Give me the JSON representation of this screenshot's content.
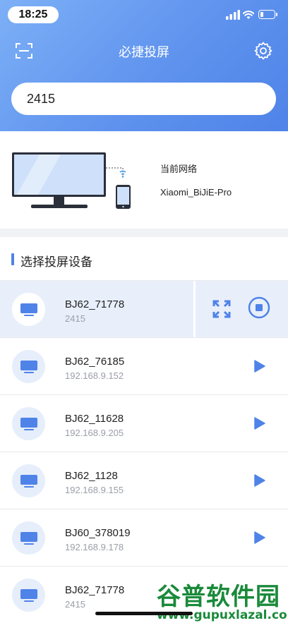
{
  "status_bar": {
    "time": "18:25",
    "battery_level": 0.25
  },
  "header": {
    "title": "必捷投屏",
    "search_value": "2415",
    "scan_icon": "scan-icon",
    "settings_icon": "gear-icon"
  },
  "network": {
    "label": "当前网络",
    "name": "Xiaomi_BiJiE-Pro"
  },
  "section": {
    "title": "选择投屏设备"
  },
  "devices": [
    {
      "name": "BJ62_71778",
      "ip": "2415"
    },
    {
      "name": "BJ62_76185",
      "ip": "192.168.9.152"
    },
    {
      "name": "BJ62_11628",
      "ip": "192.168.9.205"
    },
    {
      "name": "BJ62_1128",
      "ip": "192.168.9.155"
    },
    {
      "name": "BJ60_378019",
      "ip": "192.168.9.178"
    },
    {
      "name": "BJ62_71778",
      "ip": "2415"
    }
  ],
  "watermark": {
    "main": "谷普软件园",
    "url": "www.gupuxlazal.com"
  },
  "colors": {
    "accent": "#4f83e8",
    "header_start": "#7db0f6",
    "header_end": "#4f83e8",
    "active_row": "#e8effb"
  }
}
